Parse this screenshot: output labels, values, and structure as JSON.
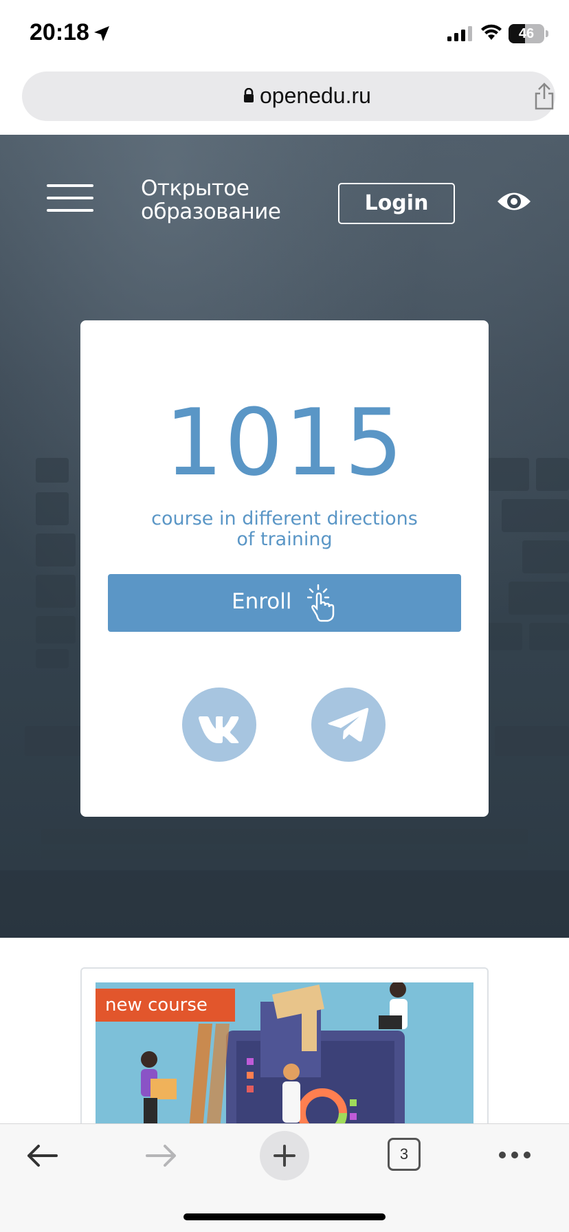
{
  "status_bar": {
    "time": "20:18",
    "battery": "46",
    "battery_level": 0.46
  },
  "browser": {
    "url": "openedu.ru",
    "open_tabs": "3"
  },
  "header": {
    "logo_line1": "Открытое",
    "logo_line2": "образование",
    "login_label": "Login"
  },
  "hero_card": {
    "count": "1015",
    "subtitle_line1": "course in different directions",
    "subtitle_line2": "of training",
    "enroll_label": "Enroll"
  },
  "course": {
    "badge": "new course"
  },
  "colors": {
    "accent": "#5b96c6",
    "social": "#a7c5e0",
    "badge": "#e2562c"
  },
  "icons": [
    "location-arrow-icon",
    "signal-icon",
    "wifi-icon",
    "battery-icon",
    "lock-icon",
    "share-icon",
    "menu-icon",
    "eye-icon",
    "pointer-icon",
    "vk-icon",
    "telegram-icon",
    "back-icon",
    "forward-icon",
    "plus-icon",
    "more-icon"
  ]
}
